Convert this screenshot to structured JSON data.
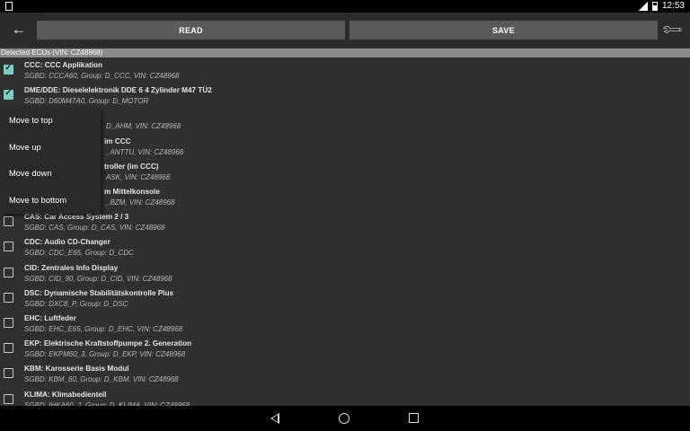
{
  "status_bar": {
    "time": "12:53"
  },
  "toolbar": {
    "read_label": "READ",
    "save_label": "SAVE"
  },
  "section_header": "Detected ECUs (VIN: CZ48968)",
  "context_menu": [
    "Move to top",
    "Move up",
    "Move down",
    "Move to bottom"
  ],
  "ecus": [
    {
      "title": "CCC: CCC Applikation",
      "subtitle": "SGBD: CCCA60, Group: D_CCC, VIN: CZ48968",
      "checked": true
    },
    {
      "title": "DME/DDE: Dieselelektronik DDE 6 4 Zylinder M47 TÜ2",
      "subtitle": "SGBD: D60M47A0, Group: D_MOTOR",
      "checked": true
    },
    {
      "title": "",
      "subtitle": "D_AHM, VIN: CZ48968",
      "checked": false
    },
    {
      "title": "im CCC",
      "subtitle": "_ANTTU, VIN: CZ48968",
      "checked": false
    },
    {
      "title": "troller (im CCC)",
      "subtitle": "ASK, VIN: CZ48968",
      "checked": false
    },
    {
      "title": "m Mittelkonsole",
      "subtitle": "_BZM, VIN: CZ48968",
      "checked": false
    },
    {
      "title": "CAS: Car Access System 2 / 3",
      "subtitle": "SGBD: CAS, Group: D_CAS, VIN: CZ48968",
      "checked": false
    },
    {
      "title": "CDC: Audio CD-Changer",
      "subtitle": "SGBD: CDC_E65, Group: D_CDC",
      "checked": false
    },
    {
      "title": "CID: Zentrales Info Display",
      "subtitle": "SGBD: CID_90, Group: D_CID, VIN: CZ48968",
      "checked": false
    },
    {
      "title": "DSC: Dynamische Stabilitätskontrolle Plus",
      "subtitle": "SGBD: DXC8_P, Group: D_DSC",
      "checked": false
    },
    {
      "title": "EHC: Luftfeder",
      "subtitle": "SGBD: EHC_E65, Group: D_EHC, VIN: CZ48968",
      "checked": false
    },
    {
      "title": "EKP: Elektrische Kraftstoffpumpe 2. Generation",
      "subtitle": "SGBD: EKPM60_3, Group: D_EKP, VIN: CZ48968",
      "checked": false
    },
    {
      "title": "KBM: Karosserie Basis Modul",
      "subtitle": "SGBD: KBM_60, Group: D_KBM, VIN: CZ48968",
      "checked": false
    },
    {
      "title": "KLIMA: Klimabedienteil",
      "subtitle": "SGBD: IHKA60_2, Group: D_KLIMA, VIN: CZ48968",
      "checked": false
    }
  ],
  "colors": {
    "accent": "#80cbc4",
    "background": "#303030",
    "button": "#5a5a5a"
  }
}
